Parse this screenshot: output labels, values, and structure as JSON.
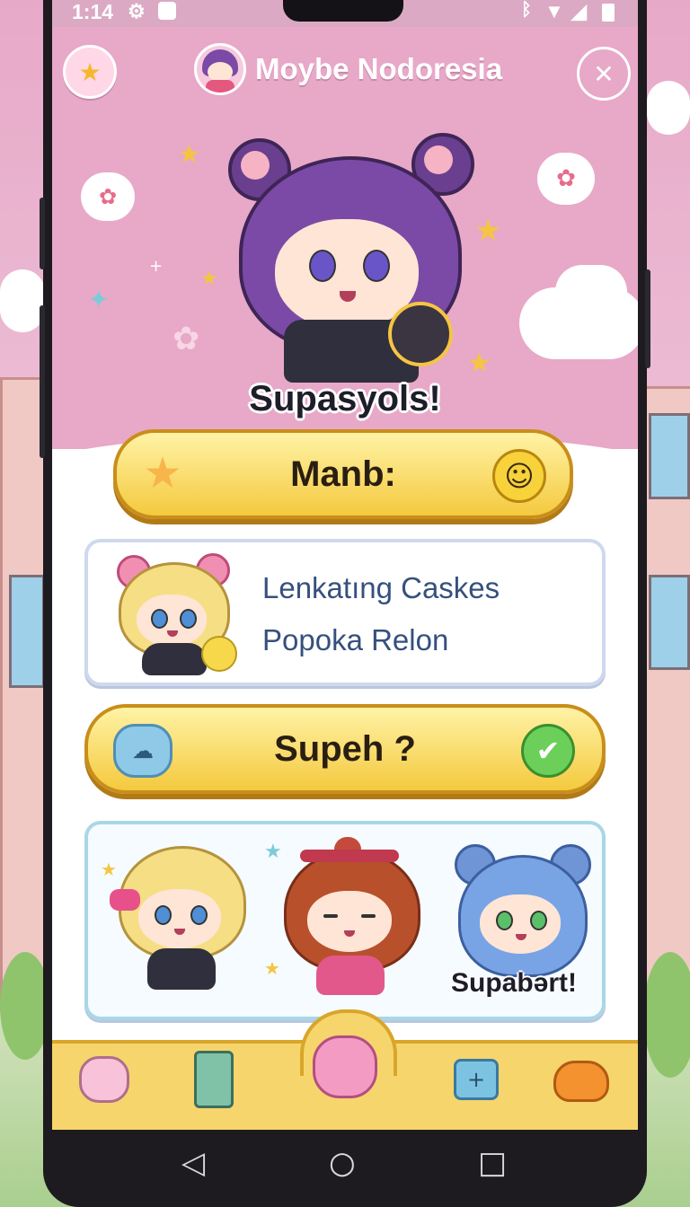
{
  "status_bar": {
    "time": "1:14",
    "left_icons": [
      "settings-icon",
      "record-icon"
    ],
    "right_icons": [
      "bluetooth-icon",
      "wifi-icon",
      "signal-icon",
      "battery-icon"
    ]
  },
  "header": {
    "title": "Moybe Nodoresia",
    "left_button_icon": "star-icon",
    "close_icon": "close-icon"
  },
  "hero": {
    "caption": "Supasyols!"
  },
  "menu_button": {
    "label": "Manb:",
    "left_icon": "star-icon",
    "right_icon": "smiley-icon"
  },
  "info_card": {
    "line1": "Lenkatıng Caskes",
    "line2": "Popoka Relon"
  },
  "confirm_button": {
    "label": "Supeh ?",
    "left_icon": "cloud-icon",
    "right_icon": "check-icon"
  },
  "character_card": {
    "caption": "Supabərt!"
  },
  "bottom_nav": {
    "items": [
      "hamster-icon",
      "game-machine-icon",
      "pig-icon",
      "medkit-icon",
      "bird-icon"
    ],
    "active_index": 2
  },
  "system_nav": [
    "back-icon",
    "home-icon",
    "recents-icon"
  ],
  "colors": {
    "accent_pink": "#e8a8c8",
    "button_yellow": "#f4c93e",
    "card_border": "#cfd8ee",
    "text_blue": "#36507e"
  }
}
